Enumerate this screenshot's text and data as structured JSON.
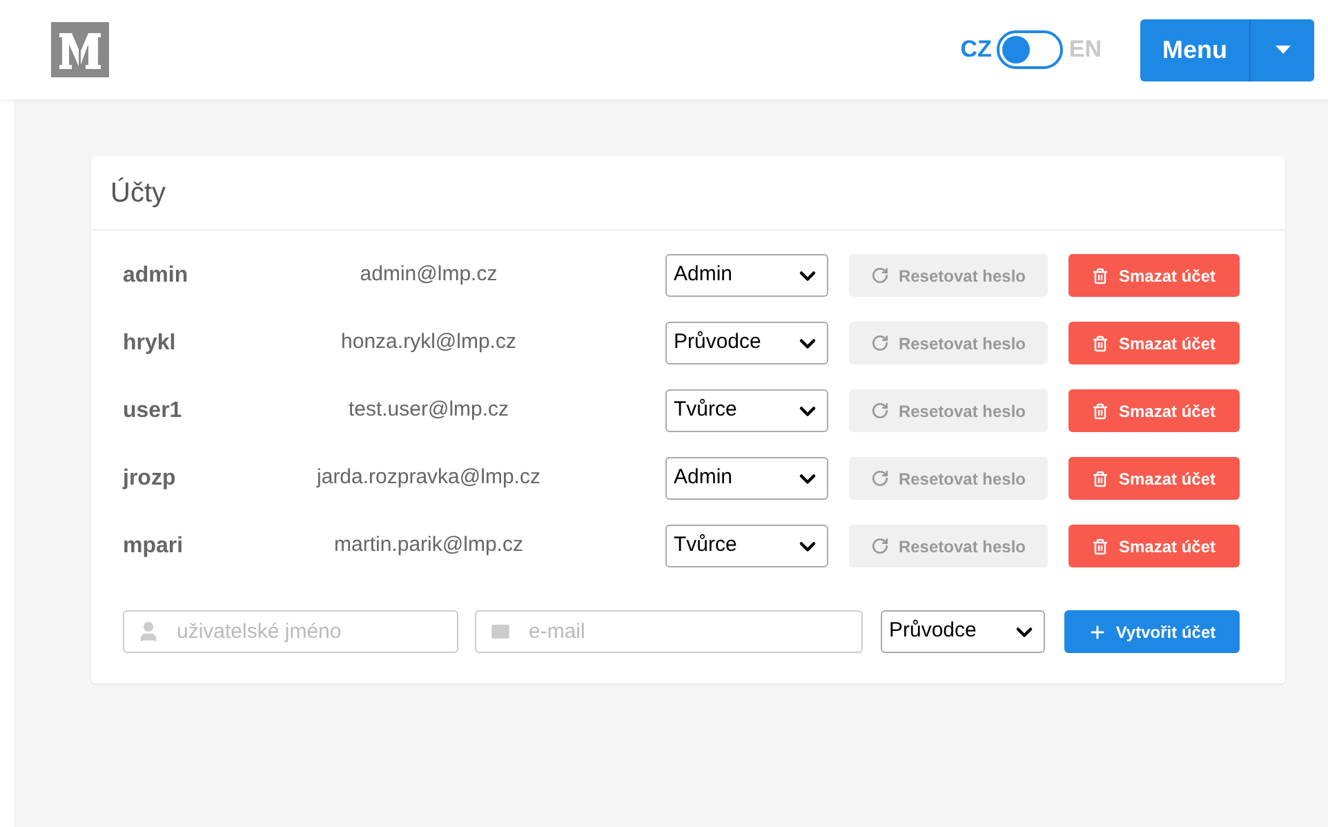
{
  "header": {
    "languages": [
      {
        "label": "CZ",
        "selected": true
      },
      {
        "label": "EN",
        "selected": false
      }
    ],
    "menu_button": "Menu"
  },
  "accounts": {
    "title": "Účty",
    "rows": [
      {
        "username": "admin",
        "email": "admin@lmp.cz",
        "role": "Admin",
        "reset": "Resetovat heslo",
        "delete": "Smazat účet"
      },
      {
        "username": "hrykl",
        "email": "honza.rykl@lmp.cz",
        "role": "Průvodce",
        "reset": "Resetovat heslo",
        "delete": "Smazat účet"
      },
      {
        "username": "user1",
        "email": "test.user@lmp.cz",
        "role": "Tvůrce",
        "reset": "Resetovat heslo",
        "delete": "Smazat účet"
      },
      {
        "username": "jrozp",
        "email": "jarda.rozpravka@lmp.cz",
        "role": "Admin",
        "reset": "Resetovat heslo",
        "delete": "Smazat účet"
      },
      {
        "username": "mpari",
        "email": "martin.parik@lmp.cz",
        "role": "Tvůrce",
        "reset": "Resetovat heslo",
        "delete": "Smazat účet"
      }
    ],
    "new_account": {
      "username_placeholder": "uživatelské jméno",
      "email_placeholder": "e-mail",
      "role": "Průvodce",
      "create": "Vytvořit účet"
    }
  }
}
